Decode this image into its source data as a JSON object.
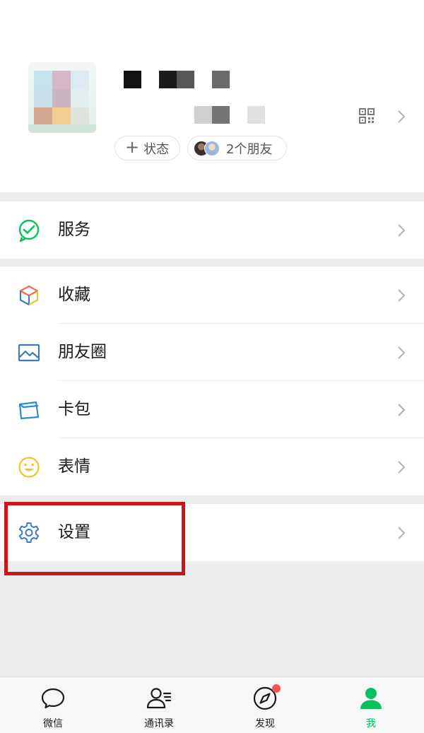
{
  "profile": {
    "status_label": "状态",
    "plus_glyph": "+",
    "friends_label": "2个朋友"
  },
  "menu": {
    "service": {
      "label": "服务",
      "icon": "service-icon",
      "color": "#07c160"
    },
    "favorites": {
      "label": "收藏",
      "icon": "favorites-cube-icon"
    },
    "moments": {
      "label": "朋友圈",
      "icon": "moments-photo-icon",
      "color": "#3d7ac0"
    },
    "cards": {
      "label": "卡包",
      "icon": "cards-wallet-icon",
      "color": "#2f8ac8"
    },
    "stickers": {
      "label": "表情",
      "icon": "sticker-smiley-icon",
      "color": "#f2c230"
    },
    "settings": {
      "label": "设置",
      "icon": "settings-gear-icon",
      "color": "#3d7ac0"
    }
  },
  "tabs": [
    {
      "label": "微信",
      "icon": "chat-bubble-icon",
      "active": false
    },
    {
      "label": "通讯录",
      "icon": "contacts-icon",
      "active": false
    },
    {
      "label": "发现",
      "icon": "discover-compass-icon",
      "active": false,
      "badge": true
    },
    {
      "label": "我",
      "icon": "me-person-icon",
      "active": true
    }
  ],
  "colors": {
    "accent": "#07c160",
    "highlight": "#c8161d",
    "badge": "#fa5151",
    "background": "#ededed"
  }
}
